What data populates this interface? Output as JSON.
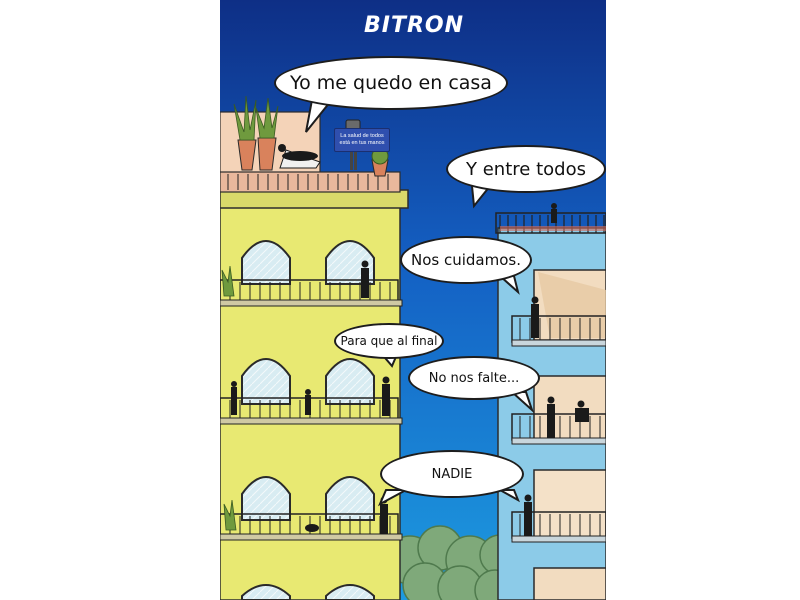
{
  "brand": {
    "logo": "BITRON"
  },
  "sign": {
    "text": "La salud de todos está en tus manos"
  },
  "bubbles": {
    "b1": "Yo me quedo en casa",
    "b2": "Y entre todos",
    "b3": "Nos cuidamos.",
    "b4": "Para que al final",
    "b5": "No nos falte...",
    "b6": "NADIE"
  },
  "colors": {
    "sky_top": "#0f3f9e",
    "sky_bottom": "#1a8fd8",
    "left_building": "#e9ea76",
    "right_building": "#89c8e6",
    "trees": "#7fa97a"
  }
}
